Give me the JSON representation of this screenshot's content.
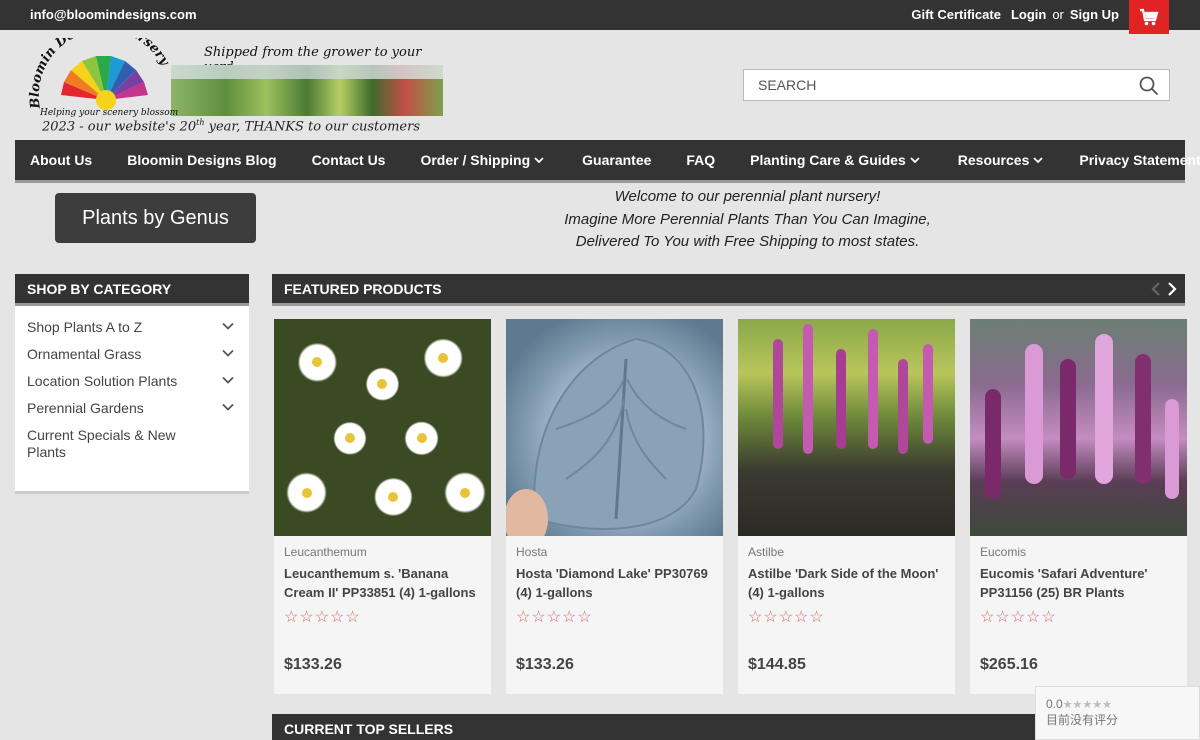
{
  "topbar": {
    "email": "info@bloomindesigns.com",
    "gift_certificate": "Gift Certificate",
    "login": "Login",
    "or": "or",
    "sign_up": "Sign Up"
  },
  "logo": {
    "brand": "Bloomin Designs Nursery",
    "shipped": "Shipped from the grower to your yard",
    "tagline": "Helping your scenery blossom",
    "year_pre": "2023 - our website's 20",
    "year_sup": "th",
    "year_post": " year, THANKS to our customers"
  },
  "search": {
    "placeholder": "SEARCH"
  },
  "nav": {
    "items": [
      {
        "label": "About Us"
      },
      {
        "label": "Bloomin Designs Blog"
      },
      {
        "label": "Contact Us"
      },
      {
        "label": "Order / Shipping"
      },
      {
        "label": "Guarantee"
      },
      {
        "label": "FAQ"
      },
      {
        "label": "Planting Care & Guides"
      },
      {
        "label": "Resources"
      },
      {
        "label": "Privacy Statement"
      }
    ]
  },
  "genus_button": "Plants by Genus",
  "welcome": {
    "line1": "Welcome to our perennial plant nursery!",
    "line2": "Imagine More Perennial Plants Than You Can Imagine,",
    "line3": "Delivered To You with Free Shipping to most states."
  },
  "sidebar": {
    "heading": "SHOP BY CATEGORY",
    "items": [
      {
        "label": "Shop Plants A to Z"
      },
      {
        "label": "Ornamental Grass"
      },
      {
        "label": "Location Solution Plants"
      },
      {
        "label": "Perennial Gardens"
      },
      {
        "label": "Current Specials & New Plants"
      }
    ]
  },
  "featured": {
    "heading": "FEATURED PRODUCTS",
    "products": [
      {
        "brand": "Leucanthemum",
        "title": "Leucanthemum s. 'Banana Cream II' PP33851 (4) 1-gallons",
        "stars": "☆☆☆☆☆",
        "price": "$133.26"
      },
      {
        "brand": "Hosta",
        "title": "Hosta 'Diamond Lake' PP30769 (4) 1-gallons",
        "stars": "☆☆☆☆☆",
        "price": "$133.26"
      },
      {
        "brand": "Astilbe",
        "title": "Astilbe 'Dark Side of the Moon' (4) 1-gallons",
        "stars": "☆☆☆☆☆",
        "price": "$144.85"
      },
      {
        "brand": "Eucomis",
        "title": "Eucomis 'Safari Adventure' PP31156 (25) BR Plants",
        "stars": "☆☆☆☆☆",
        "price": "$265.16"
      }
    ]
  },
  "top_sellers": {
    "heading": "CURRENT TOP SELLERS"
  },
  "rating_widget": {
    "score": "0.0",
    "stars": "★★★★★",
    "text": "目前没有评分"
  },
  "colors": {
    "dark_bar": "#333333",
    "cart_red": "#e02424",
    "star_outline": "#d76a6a"
  }
}
